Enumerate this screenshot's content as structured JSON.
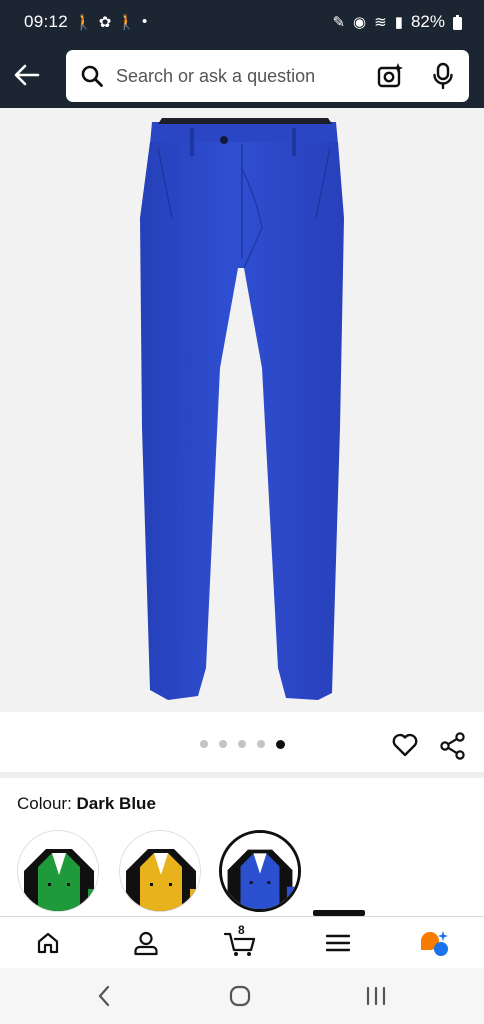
{
  "status_bar": {
    "time": "09:12",
    "battery": "82%",
    "left_icons": [
      "walking-icon",
      "pinwheel-icon",
      "walking-icon",
      "dot-icon"
    ],
    "right_icons": [
      "pen-icon",
      "hotspot-icon",
      "wifi-icon",
      "signal-icon",
      "battery-icon"
    ]
  },
  "header": {
    "search_placeholder": "Search or ask a question",
    "icons": [
      "back-arrow-icon",
      "search-icon",
      "camera-sparkle-icon",
      "microphone-icon"
    ]
  },
  "gallery": {
    "image_count": 5,
    "active_index": 4
  },
  "colour": {
    "label": "Colour: ",
    "value": "Dark Blue"
  },
  "swatches": [
    {
      "name": "green",
      "color": "#1e9a3a",
      "selected": false
    },
    {
      "name": "yellow",
      "color": "#e8b21c",
      "selected": false
    },
    {
      "name": "blue",
      "color": "#2a4fcf",
      "selected": true
    }
  ],
  "bottom_nav": {
    "cart_count": "8",
    "items": [
      "home-icon",
      "account-icon",
      "cart-icon",
      "menu-icon",
      "assistant-icon"
    ]
  },
  "colors": {
    "header_bg": "#1c2632",
    "pants_blue": "#2d49c8",
    "accent_orange": "#f57c00",
    "accent_blue": "#1a73e8"
  }
}
